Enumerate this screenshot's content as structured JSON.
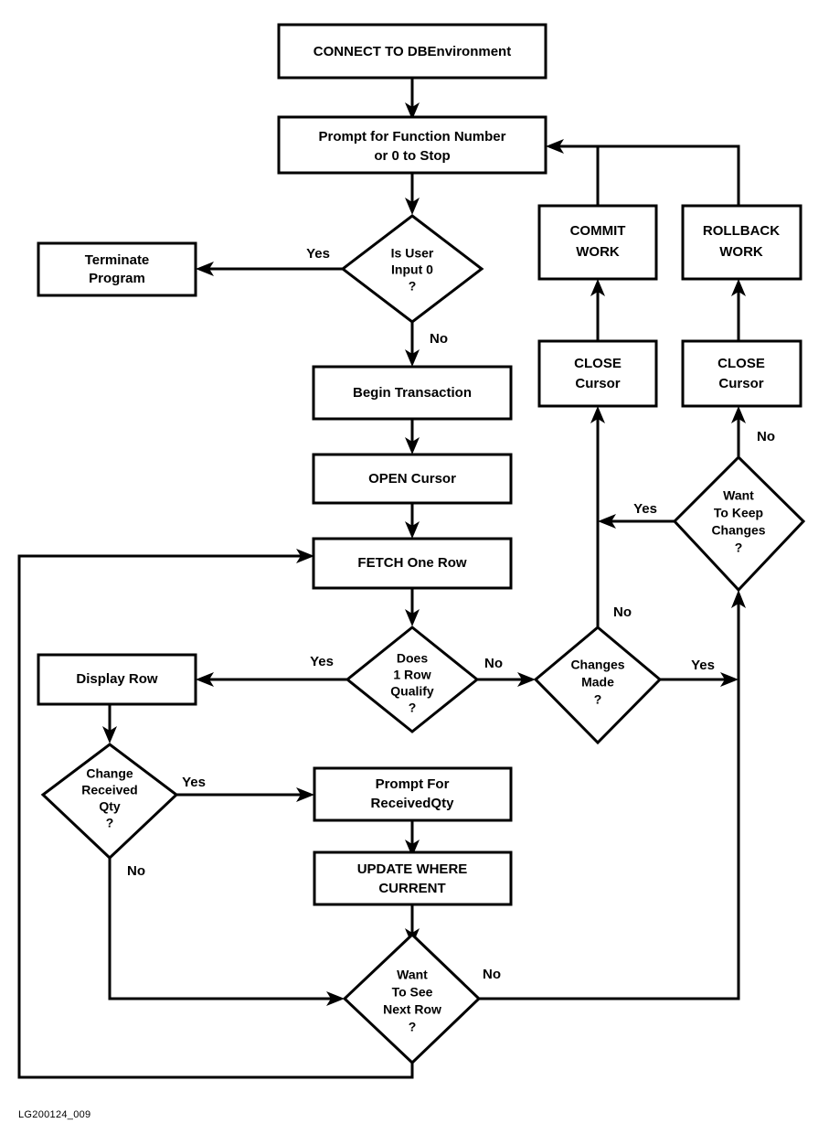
{
  "figure": {
    "caption": "LG200124_009",
    "type": "flowchart",
    "colors": {
      "background": "#ffffff",
      "stroke": "#000000",
      "fill": "#ffffff",
      "text": "#000000"
    }
  },
  "nodes": {
    "connect": {
      "shape": "process",
      "lines": [
        "CONNECT TO DBEnvironment"
      ]
    },
    "prompt_function": {
      "shape": "process",
      "lines": [
        "Prompt for Function Number",
        "or 0 to Stop"
      ]
    },
    "is_user_input_0": {
      "shape": "decision",
      "lines": [
        "Is User",
        "Input 0",
        "?"
      ]
    },
    "terminate": {
      "shape": "process",
      "lines": [
        "Terminate",
        "Program"
      ]
    },
    "begin_transaction": {
      "shape": "process",
      "lines": [
        "Begin Transaction"
      ]
    },
    "open_cursor": {
      "shape": "process",
      "lines": [
        "OPEN Cursor"
      ]
    },
    "fetch_one_row": {
      "shape": "process",
      "lines": [
        "FETCH One Row"
      ]
    },
    "does_1_row_qualify": {
      "shape": "decision",
      "lines": [
        "Does",
        "1 Row",
        "Qualify",
        "?"
      ]
    },
    "display_row": {
      "shape": "process",
      "lines": [
        "Display Row"
      ]
    },
    "change_received_qty": {
      "shape": "decision",
      "lines": [
        "Change",
        "Received",
        "Qty",
        "?"
      ]
    },
    "prompt_received_qty": {
      "shape": "process",
      "lines": [
        "Prompt For",
        "ReceivedQty"
      ]
    },
    "update_where_current": {
      "shape": "process",
      "lines": [
        "UPDATE WHERE",
        "CURRENT"
      ]
    },
    "want_to_see_next_row": {
      "shape": "decision",
      "lines": [
        "Want",
        "To See",
        "Next Row",
        "?"
      ]
    },
    "changes_made": {
      "shape": "decision",
      "lines": [
        "Changes",
        "Made",
        "?"
      ]
    },
    "want_to_keep_changes": {
      "shape": "decision",
      "lines": [
        "Want",
        "To Keep",
        "Changes",
        "?"
      ]
    },
    "close_cursor_commit": {
      "shape": "process",
      "lines": [
        "CLOSE",
        "Cursor"
      ]
    },
    "close_cursor_rollback": {
      "shape": "process",
      "lines": [
        "CLOSE",
        "Cursor"
      ]
    },
    "commit_work": {
      "shape": "process",
      "lines": [
        "COMMIT",
        "WORK"
      ]
    },
    "rollback_work": {
      "shape": "process",
      "lines": [
        "ROLLBACK",
        "WORK"
      ]
    }
  },
  "edge_labels": {
    "input0_yes": "Yes",
    "input0_no": "No",
    "qualify_yes": "Yes",
    "qualify_no": "No",
    "change_qty_yes": "Yes",
    "change_qty_no": "No",
    "next_row_no": "No",
    "changes_made_no": "No",
    "changes_made_yes": "Yes",
    "keep_changes_yes": "Yes",
    "keep_changes_no": "No"
  },
  "edges": [
    {
      "from": "connect",
      "to": "prompt_function",
      "label": ""
    },
    {
      "from": "prompt_function",
      "to": "is_user_input_0",
      "label": ""
    },
    {
      "from": "is_user_input_0",
      "to": "terminate",
      "label": "Yes"
    },
    {
      "from": "is_user_input_0",
      "to": "begin_transaction",
      "label": "No"
    },
    {
      "from": "begin_transaction",
      "to": "open_cursor",
      "label": ""
    },
    {
      "from": "open_cursor",
      "to": "fetch_one_row",
      "label": ""
    },
    {
      "from": "fetch_one_row",
      "to": "does_1_row_qualify",
      "label": ""
    },
    {
      "from": "does_1_row_qualify",
      "to": "display_row",
      "label": "Yes"
    },
    {
      "from": "does_1_row_qualify",
      "to": "changes_made",
      "label": "No"
    },
    {
      "from": "display_row",
      "to": "change_received_qty",
      "label": ""
    },
    {
      "from": "change_received_qty",
      "to": "prompt_received_qty",
      "label": "Yes"
    },
    {
      "from": "change_received_qty",
      "to": "want_to_see_next_row",
      "label": "No"
    },
    {
      "from": "prompt_received_qty",
      "to": "update_where_current",
      "label": ""
    },
    {
      "from": "update_where_current",
      "to": "want_to_see_next_row",
      "label": ""
    },
    {
      "from": "want_to_see_next_row",
      "to": "fetch_one_row",
      "label": ""
    },
    {
      "from": "want_to_see_next_row",
      "to": "want_to_keep_changes",
      "label": "No"
    },
    {
      "from": "changes_made",
      "to": "close_cursor_commit",
      "label": "No"
    },
    {
      "from": "changes_made",
      "to": "want_to_keep_changes",
      "label": "Yes"
    },
    {
      "from": "want_to_keep_changes",
      "to": "close_cursor_commit",
      "label": "Yes"
    },
    {
      "from": "want_to_keep_changes",
      "to": "close_cursor_rollback",
      "label": "No"
    },
    {
      "from": "close_cursor_commit",
      "to": "commit_work",
      "label": ""
    },
    {
      "from": "close_cursor_rollback",
      "to": "rollback_work",
      "label": ""
    },
    {
      "from": "commit_work",
      "to": "prompt_function",
      "label": ""
    },
    {
      "from": "rollback_work",
      "to": "prompt_function",
      "label": ""
    }
  ]
}
